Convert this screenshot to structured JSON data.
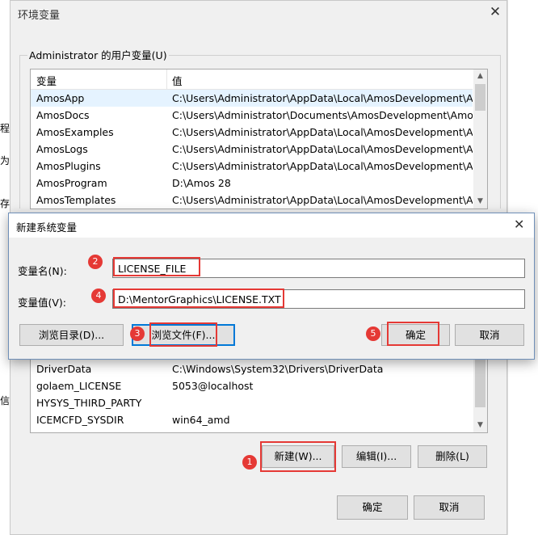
{
  "window": {
    "title": "环境变量",
    "user_group_title": "Administrator 的用户变量(U)",
    "columns": [
      "变量",
      "值"
    ],
    "user_vars": [
      {
        "name": "AmosApp",
        "value": "C:\\Users\\Administrator\\AppData\\Local\\AmosDevelopment\\A..."
      },
      {
        "name": "AmosDocs",
        "value": "C:\\Users\\Administrator\\Documents\\AmosDevelopment\\Amos..."
      },
      {
        "name": "AmosExamples",
        "value": "C:\\Users\\Administrator\\AppData\\Local\\AmosDevelopment\\A..."
      },
      {
        "name": "AmosLogs",
        "value": "C:\\Users\\Administrator\\AppData\\Local\\AmosDevelopment\\A..."
      },
      {
        "name": "AmosPlugins",
        "value": "C:\\Users\\Administrator\\AppData\\Local\\AmosDevelopment\\A..."
      },
      {
        "name": "AmosProgram",
        "value": "D:\\Amos 28"
      },
      {
        "name": "AmosTemplates",
        "value": "C:\\Users\\Administrator\\AppData\\Local\\AmosDevelopment\\A..."
      }
    ],
    "system_vars": [
      {
        "name": "DriverData",
        "value": "C:\\Windows\\System32\\Drivers\\DriverData"
      },
      {
        "name": "golaem_LICENSE",
        "value": "5053@localhost"
      },
      {
        "name": "HYSYS_THIRD_PARTY",
        "value": ""
      },
      {
        "name": "ICEMCFD_SYSDIR",
        "value": "win64_amd"
      }
    ],
    "buttons": {
      "new": "新建(W)...",
      "edit": "编辑(I)...",
      "delete": "删除(L)",
      "ok": "确定",
      "cancel": "取消"
    }
  },
  "background_chars": [
    "程",
    "为",
    "存",
    "信"
  ],
  "dialog": {
    "title": "新建系统变量",
    "name_label": "变量名(N):",
    "name_value": "LICENSE_FILE",
    "value_label": "变量值(V):",
    "value_value": "D:\\MentorGraphics\\LICENSE.TXT",
    "browse_dir": "浏览目录(D)...",
    "browse_file": "浏览文件(F)...",
    "ok": "确定",
    "cancel": "取消"
  },
  "steps": [
    "1",
    "2",
    "3",
    "4",
    "5"
  ],
  "colors": {
    "accent": "#0078d7",
    "highlight": "#e53935",
    "selection": "#e5f3ff"
  }
}
